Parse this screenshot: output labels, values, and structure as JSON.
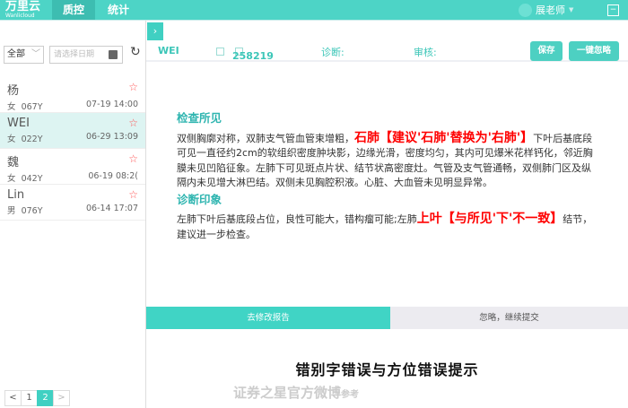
{
  "header": {
    "logo": "万里云",
    "logo_sub": "Wanlicloud",
    "nav": [
      "质控",
      "统计"
    ],
    "user": "展老师"
  },
  "sidebar": {
    "filter": "全部",
    "date_placeholder": "请选择日期",
    "patients": [
      {
        "name": "杨",
        "sex": "女",
        "age": "067Y",
        "time": "07-19 14:00"
      },
      {
        "name": "WEI",
        "sex": "女",
        "age": "022Y",
        "time": "06-29 13:09",
        "selected": true
      },
      {
        "name": "魏",
        "sex": "女",
        "age": "042Y",
        "time": "06-19 08:2("
      },
      {
        "name": "Lin",
        "sex": "男",
        "age": "076Y",
        "time": "06-14 17:07"
      }
    ],
    "pages": [
      "<",
      "1",
      "2",
      ">"
    ],
    "current_page": "2"
  },
  "patient_bar": {
    "name": "WEI",
    "id": "258219",
    "diagnosis_label": "诊断:",
    "review_label": "审核:",
    "save": "保存",
    "ignore_all": "一键忽略"
  },
  "report": {
    "findings_title": "检查所见",
    "findings": [
      "双侧胸廓对称，双肺支气管血管束增粗，",
      "石肺【建议'石肺'替换为'右肺'】",
      "下叶后基底段可见一直径约2cm的软组织密度肿块影，边缘光滑，密度均匀，其内可见爆米花样钙化，邻近胸膜未见凹陷征象。左肺下可见斑点片状、结节状高密度灶。气管及支气管通畅，双侧肺门区及纵隔内未见增大淋巴结。双侧未见胸腔积液。心脏、大血管未见明显异常。"
    ],
    "impression_title": "诊断印象",
    "impression": [
      "左肺下叶后基底段占位，良性可能大，错构瘤可能;左肺",
      "上叶【与所见'下'不一致】",
      "结节，建议进一步检查。"
    ]
  },
  "actions": {
    "modify": "去修改报告",
    "ignore": "忽略，继续提交"
  },
  "caption": "错别字错误与方位错误提示",
  "watermark": "证券之星官方微博",
  "watermark_suffix": "参考",
  "colors": {
    "accent": "#4dd4c6",
    "error": "#ff0000"
  }
}
